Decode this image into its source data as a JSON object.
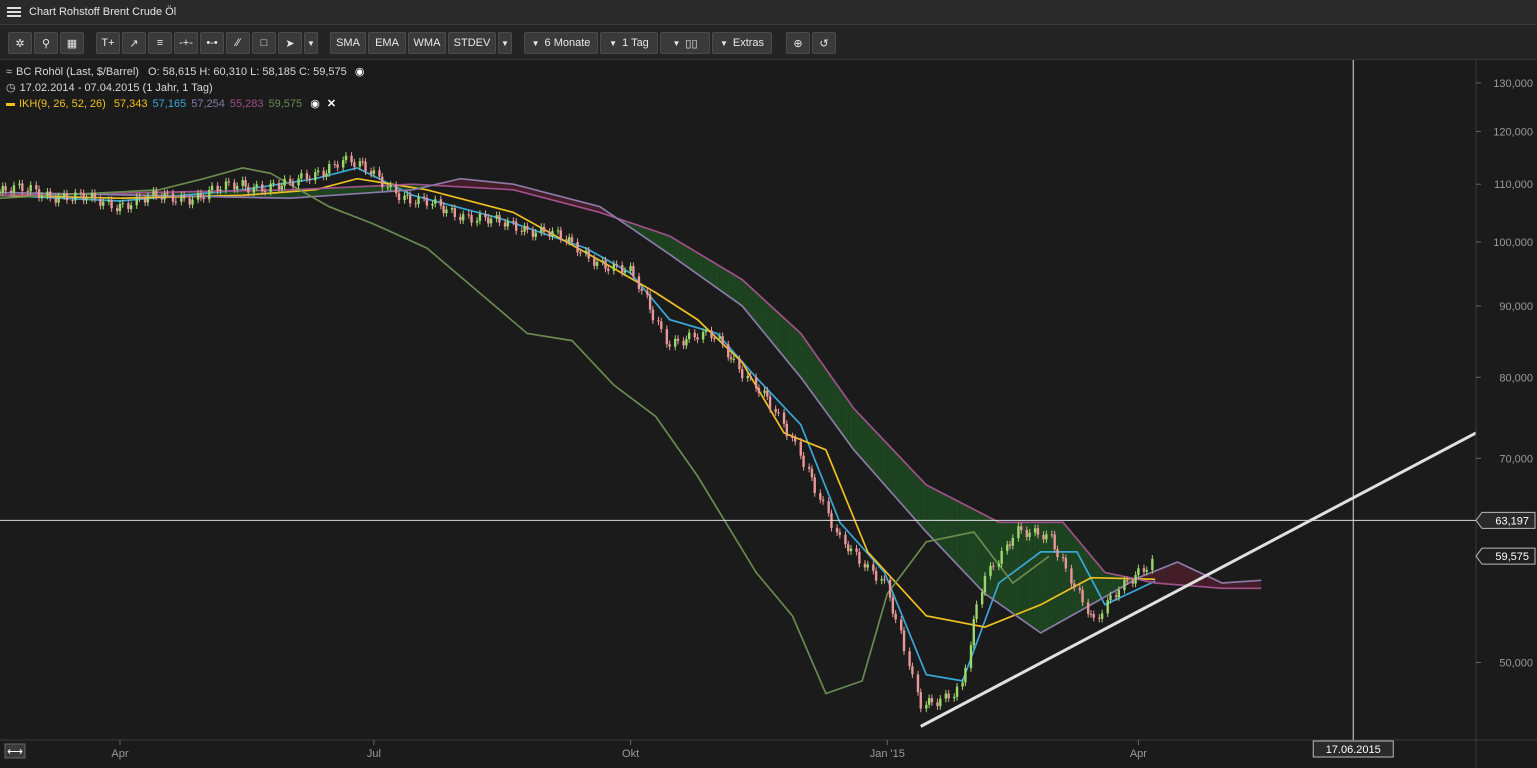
{
  "window": {
    "title": "Chart Rohstoff Brent Crude Öl"
  },
  "toolbar": {
    "ma_buttons": [
      "SMA",
      "EMA",
      "WMA",
      "STDEV"
    ],
    "period": "6 Monate",
    "interval": "1 Tag",
    "extras": "Extras"
  },
  "info": {
    "instrument": "BC Rohöl (Last, $/Barrel)",
    "ohlc": "O: 58,615  H: 60,310  L: 58,185  C: 59,575",
    "range": "17.02.2014 - 07.04.2015 (1 Jahr, 1 Tag)",
    "indicator": "IKH(9, 26, 52, 26)",
    "ind_values": [
      {
        "text": "57,343",
        "color": "#f0c020"
      },
      {
        "text": "57,165",
        "color": "#38a8d8"
      },
      {
        "text": "57,254",
        "color": "#8a7aa8"
      },
      {
        "text": "55,283",
        "color": "#a0508a"
      },
      {
        "text": "59,575",
        "color": "#6a8a50"
      }
    ]
  },
  "chart_data": {
    "type": "line",
    "title": "BC Rohöl (Last, $/Barrel)",
    "y_scale": "log",
    "ylim": [
      44,
      135
    ],
    "y_ticks": [
      {
        "v": 130,
        "label": "130,000"
      },
      {
        "v": 120,
        "label": "120,000"
      },
      {
        "v": 110,
        "label": "110,000"
      },
      {
        "v": 100,
        "label": "100,000"
      },
      {
        "v": 90,
        "label": "90,000"
      },
      {
        "v": 80,
        "label": "80,000"
      },
      {
        "v": 70,
        "label": "70,000"
      },
      {
        "v": 50,
        "label": "50,000"
      }
    ],
    "x_range": [
      "2014-02-17",
      "2015-07-31"
    ],
    "x_ticks": [
      {
        "date": "2014-04-01",
        "label": "Apr"
      },
      {
        "date": "2014-07-01",
        "label": "Jul"
      },
      {
        "date": "2014-10-01",
        "label": "Okt"
      },
      {
        "date": "2015-01-01",
        "label": "Jan '15"
      },
      {
        "date": "2015-04-01",
        "label": "Apr"
      }
    ],
    "crosshair": {
      "date": "2015-06-17",
      "value": 63.197,
      "date_label": "17.06.2015",
      "value_label": "63,197"
    },
    "last_price": {
      "value": 59.575,
      "label": "59,575"
    },
    "price_series": [
      [
        "2014-02-17",
        108.5
      ],
      [
        "2014-03-01",
        109.0
      ],
      [
        "2014-03-15",
        107.5
      ],
      [
        "2014-04-01",
        106.5
      ],
      [
        "2014-04-15",
        107.5
      ],
      [
        "2014-05-01",
        108.0
      ],
      [
        "2014-05-15",
        110.0
      ],
      [
        "2014-06-01",
        109.5
      ],
      [
        "2014-06-10",
        112.0
      ],
      [
        "2014-06-20",
        114.5
      ],
      [
        "2014-07-01",
        112.0
      ],
      [
        "2014-07-15",
        107.0
      ],
      [
        "2014-08-01",
        105.0
      ],
      [
        "2014-08-15",
        103.0
      ],
      [
        "2014-09-01",
        102.0
      ],
      [
        "2014-09-15",
        98.0
      ],
      [
        "2014-10-01",
        95.0
      ],
      [
        "2014-10-15",
        85.0
      ],
      [
        "2014-11-01",
        85.5
      ],
      [
        "2014-11-15",
        79.0
      ],
      [
        "2014-12-01",
        71.0
      ],
      [
        "2014-12-15",
        61.0
      ],
      [
        "2014-12-31",
        57.5
      ],
      [
        "2015-01-13",
        46.5
      ],
      [
        "2015-01-28",
        48.0
      ],
      [
        "2015-02-05",
        57.0
      ],
      [
        "2015-02-17",
        62.5
      ],
      [
        "2015-03-01",
        61.0
      ],
      [
        "2015-03-17",
        53.5
      ],
      [
        "2015-03-25",
        56.0
      ],
      [
        "2015-04-07",
        59.575
      ]
    ],
    "series": [
      {
        "name": "IKH Tenkan",
        "color": "#38a8d8",
        "points": [
          [
            "2014-02-17",
            108.0
          ],
          [
            "2014-04-01",
            107.0
          ],
          [
            "2014-05-15",
            109.0
          ],
          [
            "2014-06-10",
            111.0
          ],
          [
            "2014-06-25",
            113.0
          ],
          [
            "2014-07-15",
            108.0
          ],
          [
            "2014-08-15",
            104.0
          ],
          [
            "2014-09-15",
            99.0
          ],
          [
            "2014-10-01",
            95.0
          ],
          [
            "2014-10-15",
            88.0
          ],
          [
            "2014-11-01",
            86.0
          ],
          [
            "2014-11-15",
            80.0
          ],
          [
            "2014-12-01",
            74.0
          ],
          [
            "2014-12-15",
            63.0
          ],
          [
            "2014-12-31",
            58.0
          ],
          [
            "2015-01-15",
            49.0
          ],
          [
            "2015-01-28",
            48.5
          ],
          [
            "2015-02-10",
            57.0
          ],
          [
            "2015-02-25",
            60.0
          ],
          [
            "2015-03-10",
            60.0
          ],
          [
            "2015-03-20",
            55.0
          ],
          [
            "2015-04-07",
            57.165
          ]
        ]
      },
      {
        "name": "IKH Kijun",
        "color": "#f0c020",
        "points": [
          [
            "2014-02-17",
            108.0
          ],
          [
            "2014-04-01",
            107.5
          ],
          [
            "2014-05-15",
            108.0
          ],
          [
            "2014-06-10",
            109.0
          ],
          [
            "2014-06-25",
            111.0
          ],
          [
            "2014-07-20",
            109.0
          ],
          [
            "2014-08-20",
            105.0
          ],
          [
            "2014-09-20",
            97.0
          ],
          [
            "2014-10-10",
            92.0
          ],
          [
            "2014-10-25",
            88.0
          ],
          [
            "2014-11-10",
            82.0
          ],
          [
            "2014-11-25",
            73.0
          ],
          [
            "2014-12-10",
            71.0
          ],
          [
            "2014-12-25",
            60.0
          ],
          [
            "2015-01-15",
            54.0
          ],
          [
            "2015-02-05",
            53.0
          ],
          [
            "2015-02-25",
            55.0
          ],
          [
            "2015-03-15",
            57.5
          ],
          [
            "2015-04-07",
            57.343
          ]
        ]
      },
      {
        "name": "IKH Senkou A",
        "color": "#a0508a",
        "points": [
          [
            "2014-02-17",
            108.0
          ],
          [
            "2014-06-01",
            109.0
          ],
          [
            "2014-07-15",
            110.0
          ],
          [
            "2014-08-20",
            109.0
          ],
          [
            "2014-09-20",
            105.0
          ],
          [
            "2014-10-15",
            101.0
          ],
          [
            "2014-11-10",
            94.0
          ],
          [
            "2014-12-01",
            86.0
          ],
          [
            "2014-12-20",
            76.0
          ],
          [
            "2015-01-15",
            67.0
          ],
          [
            "2015-02-10",
            63.0
          ],
          [
            "2015-03-05",
            63.0
          ],
          [
            "2015-03-20",
            58.0
          ],
          [
            "2015-04-07",
            57.0
          ],
          [
            "2015-05-01",
            56.5
          ],
          [
            "2015-05-15",
            56.5
          ]
        ]
      },
      {
        "name": "IKH Senkou B",
        "color": "#8a7aa8",
        "points": [
          [
            "2014-02-17",
            108.5
          ],
          [
            "2014-06-01",
            107.5
          ],
          [
            "2014-07-15",
            109.0
          ],
          [
            "2014-08-01",
            111.0
          ],
          [
            "2014-08-20",
            110.0
          ],
          [
            "2014-09-20",
            106.0
          ],
          [
            "2014-10-15",
            98.0
          ],
          [
            "2014-11-10",
            90.0
          ],
          [
            "2014-12-01",
            80.0
          ],
          [
            "2014-12-20",
            71.0
          ],
          [
            "2015-01-15",
            62.0
          ],
          [
            "2015-02-05",
            56.0
          ],
          [
            "2015-02-25",
            52.5
          ],
          [
            "2015-03-15",
            55.0
          ],
          [
            "2015-04-01",
            57.5
          ],
          [
            "2015-04-15",
            59.0
          ],
          [
            "2015-05-01",
            57.0
          ],
          [
            "2015-05-15",
            57.254
          ]
        ]
      },
      {
        "name": "IKH Chikou",
        "color": "#6a8a50",
        "points": [
          [
            "2014-02-17",
            107.5
          ],
          [
            "2014-04-15",
            109.0
          ],
          [
            "2014-05-01",
            111.0
          ],
          [
            "2014-05-15",
            113.0
          ],
          [
            "2014-05-25",
            112.0
          ],
          [
            "2014-06-15",
            106.0
          ],
          [
            "2014-07-01",
            103.0
          ],
          [
            "2014-07-20",
            99.0
          ],
          [
            "2014-08-05",
            93.0
          ],
          [
            "2014-08-25",
            86.0
          ],
          [
            "2014-09-10",
            85.0
          ],
          [
            "2014-09-25",
            79.0
          ],
          [
            "2014-10-10",
            75.0
          ],
          [
            "2014-10-25",
            68.0
          ],
          [
            "2014-11-15",
            58.0
          ],
          [
            "2014-11-28",
            54.0
          ],
          [
            "2014-12-10",
            47.5
          ],
          [
            "2014-12-23",
            48.5
          ],
          [
            "2015-01-01",
            56.0
          ],
          [
            "2015-01-15",
            61.0
          ],
          [
            "2015-02-01",
            62.0
          ],
          [
            "2015-02-15",
            57.0
          ],
          [
            "2015-02-28",
            59.575
          ]
        ]
      }
    ],
    "trendline": {
      "from": [
        "2015-01-13",
        45.0
      ],
      "to": [
        "2015-07-31",
        73.0
      ]
    }
  }
}
